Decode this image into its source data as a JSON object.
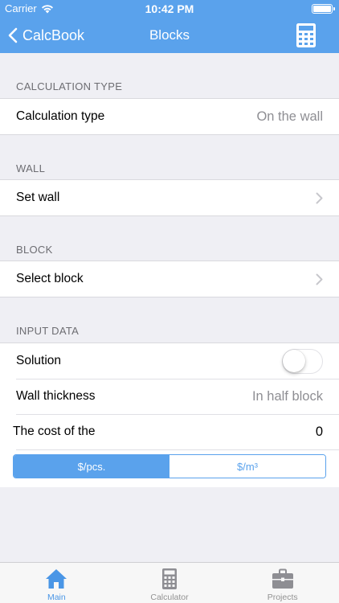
{
  "status_bar": {
    "carrier": "Carrier",
    "time": "10:42 PM"
  },
  "nav": {
    "back_label": "CalcBook",
    "title": "Blocks",
    "right_icon": "calculator-icon"
  },
  "sections": {
    "calculation_type": {
      "header": "CALCULATION TYPE",
      "row_label": "Calculation type",
      "row_value": "On the wall"
    },
    "wall": {
      "header": "WALL",
      "row_label": "Set wall"
    },
    "block": {
      "header": "BLOCK",
      "row_label": "Select block"
    },
    "input_data": {
      "header": "INPUT DATA",
      "solution_label": "Solution",
      "solution_on": false,
      "thickness_label": "Wall thickness",
      "thickness_value": "In half block",
      "cost_label": "The cost of the",
      "cost_value": "0",
      "units": [
        "$/pcs.",
        "$/m³"
      ],
      "selected_unit": "$/pcs."
    }
  },
  "tabs": [
    {
      "label": "Main",
      "icon": "home-icon",
      "active": true
    },
    {
      "label": "Calculator",
      "icon": "calculator-icon",
      "active": false
    },
    {
      "label": "Projects",
      "icon": "briefcase-icon",
      "active": false
    }
  ],
  "colors": {
    "accent": "#5aa2ec",
    "background": "#efeff4"
  }
}
